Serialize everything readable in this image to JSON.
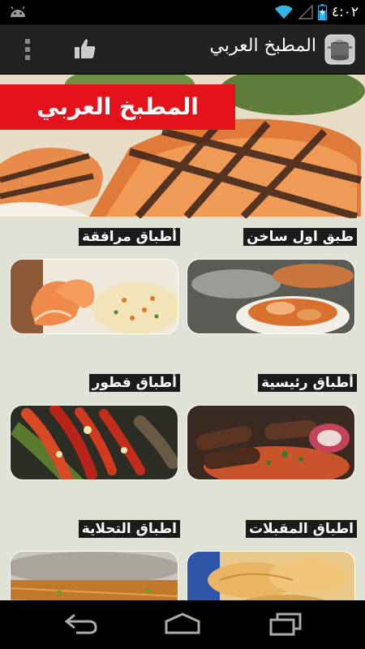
{
  "status_bar": {
    "time": "٤:٠٢",
    "icons": [
      "android-icon",
      "wifi-icon",
      "signal-icon",
      "battery-icon"
    ]
  },
  "action_bar": {
    "title": "المطبخ العربي",
    "icons": [
      "overflow-menu-icon",
      "thumbs-up-icon",
      "app-logo-icon"
    ]
  },
  "banner": {
    "label": "المطبخ العربي"
  },
  "categories": [
    {
      "label": "طبق اول ساخن"
    },
    {
      "label": "أطباق مرافقة"
    },
    {
      "label": "أطباق رئيسية"
    },
    {
      "label": "أطباق فطور"
    },
    {
      "label": "اطباق المقبلات"
    },
    {
      "label": "اطباق التحلاية"
    }
  ],
  "nav_bar": {
    "icons": [
      "back-icon",
      "home-icon",
      "recent-apps-icon"
    ]
  },
  "colors": {
    "background": "#dfe3d6",
    "action_bar": "#222222",
    "banner_label": "#e4131b",
    "category_label": "#1b1b1b"
  }
}
